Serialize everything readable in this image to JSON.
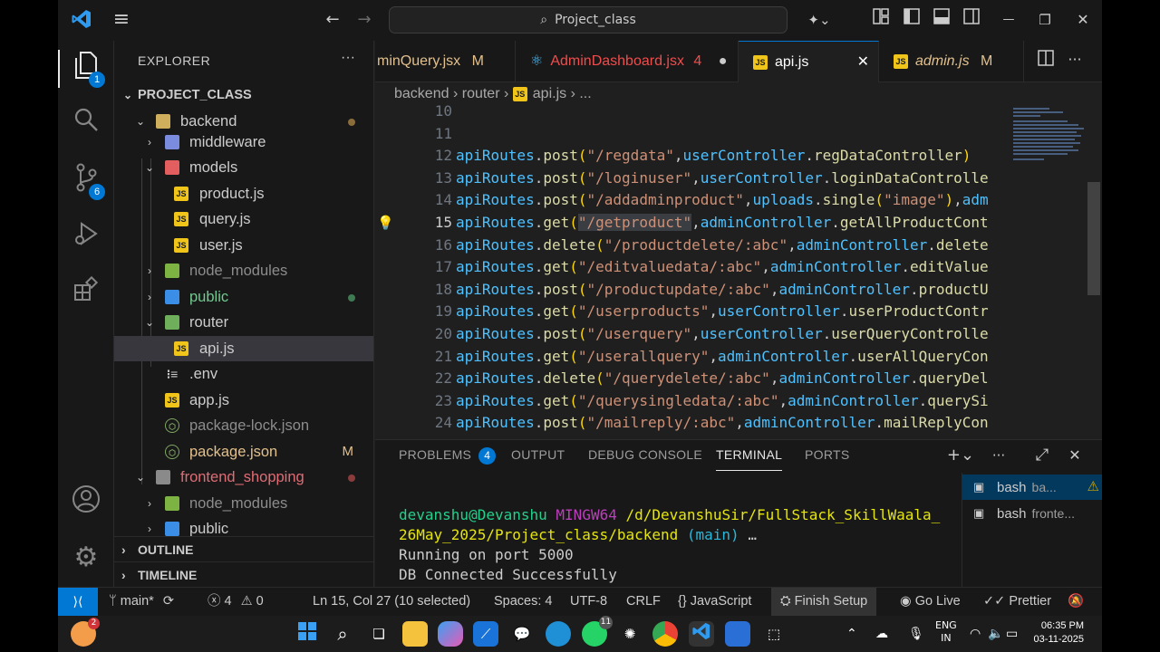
{
  "titlebar": {
    "search_text": "Project_class",
    "back": "←",
    "forward": "→",
    "menu": "≡",
    "copilot": "✦⌄",
    "minimize": "—",
    "maximize": "❐",
    "close": "✕"
  },
  "activity": {
    "explorer_badge": "1",
    "scm_badge": "6"
  },
  "sidebar": {
    "title": "EXPLORER",
    "more": "···",
    "project": "PROJECT_CLASS",
    "tree": [
      {
        "label": "backend",
        "git": "dot"
      },
      {
        "label": "middleware"
      },
      {
        "label": "models"
      },
      {
        "label": "product.js"
      },
      {
        "label": "query.js"
      },
      {
        "label": "user.js"
      },
      {
        "label": "node_modules"
      },
      {
        "label": "public",
        "git": "dot"
      },
      {
        "label": "router"
      },
      {
        "label": "api.js"
      },
      {
        "label": ".env"
      },
      {
        "label": "app.js"
      },
      {
        "label": "package-lock.json"
      },
      {
        "label": "package.json",
        "git": "M"
      },
      {
        "label": "frontend_shopping",
        "git": "dot"
      },
      {
        "label": "node_modules"
      },
      {
        "label": "public"
      }
    ],
    "outline": "OUTLINE",
    "timeline": "TIMELINE"
  },
  "tabs": [
    {
      "label": "minQuery.jsx",
      "status": "M"
    },
    {
      "label": "AdminDashboard.jsx",
      "status": "4"
    },
    {
      "label": "api.js"
    },
    {
      "label": "admin.js",
      "status": "M"
    }
  ],
  "breadcrumb": {
    "folder1": "backend",
    "folder2": "router",
    "file": "api.js",
    "more": "..."
  },
  "code": [
    {
      "n": "10",
      "tokens": []
    },
    {
      "n": "11",
      "tokens": []
    },
    {
      "n": "12",
      "tokens": [
        [
          "var",
          "apiRoutes"
        ],
        [
          "pl",
          "."
        ],
        [
          "fn",
          "post"
        ],
        [
          "p",
          "("
        ],
        [
          "str",
          "\"/regdata\""
        ],
        [
          "pl",
          ","
        ],
        [
          "var",
          "userController"
        ],
        [
          "pl",
          "."
        ],
        [
          "fn",
          "regDataController"
        ],
        [
          "p",
          ")"
        ]
      ]
    },
    {
      "n": "13",
      "tokens": [
        [
          "var",
          "apiRoutes"
        ],
        [
          "pl",
          "."
        ],
        [
          "fn",
          "post"
        ],
        [
          "p",
          "("
        ],
        [
          "str",
          "\"/loginuser\""
        ],
        [
          "pl",
          ","
        ],
        [
          "var",
          "userController"
        ],
        [
          "pl",
          "."
        ],
        [
          "fn",
          "loginDataControlle"
        ]
      ]
    },
    {
      "n": "14",
      "tokens": [
        [
          "var",
          "apiRoutes"
        ],
        [
          "pl",
          "."
        ],
        [
          "fn",
          "post"
        ],
        [
          "p",
          "("
        ],
        [
          "str",
          "\"/addadminproduct\""
        ],
        [
          "pl",
          ","
        ],
        [
          "var",
          "uploads"
        ],
        [
          "pl",
          "."
        ],
        [
          "fn",
          "single"
        ],
        [
          "p",
          "("
        ],
        [
          "str",
          "\"image\""
        ],
        [
          "p",
          ")"
        ],
        [
          "pl",
          ","
        ],
        [
          "var",
          "adm"
        ]
      ]
    },
    {
      "n": "15",
      "tokens": [
        [
          "var",
          "apiRoutes"
        ],
        [
          "pl",
          "."
        ],
        [
          "fn",
          "get"
        ],
        [
          "p",
          "("
        ],
        [
          "str",
          "\"/getproduct\""
        ],
        [
          "pl",
          ","
        ],
        [
          "var",
          "adminController"
        ],
        [
          "pl",
          "."
        ],
        [
          "fn",
          "getAllProductCont"
        ]
      ]
    },
    {
      "n": "16",
      "tokens": [
        [
          "var",
          "apiRoutes"
        ],
        [
          "pl",
          "."
        ],
        [
          "fn",
          "delete"
        ],
        [
          "p",
          "("
        ],
        [
          "str",
          "\"/productdelete/:abc\""
        ],
        [
          "pl",
          ","
        ],
        [
          "var",
          "adminController"
        ],
        [
          "pl",
          "."
        ],
        [
          "fn",
          "delete"
        ]
      ]
    },
    {
      "n": "17",
      "tokens": [
        [
          "var",
          "apiRoutes"
        ],
        [
          "pl",
          "."
        ],
        [
          "fn",
          "get"
        ],
        [
          "p",
          "("
        ],
        [
          "str",
          "\"/editvaluedata/:abc\""
        ],
        [
          "pl",
          ","
        ],
        [
          "var",
          "adminController"
        ],
        [
          "pl",
          "."
        ],
        [
          "fn",
          "editValue"
        ]
      ]
    },
    {
      "n": "18",
      "tokens": [
        [
          "var",
          "apiRoutes"
        ],
        [
          "pl",
          "."
        ],
        [
          "fn",
          "post"
        ],
        [
          "p",
          "("
        ],
        [
          "str",
          "\"/productupdate/:abc\""
        ],
        [
          "pl",
          ","
        ],
        [
          "var",
          "adminController"
        ],
        [
          "pl",
          "."
        ],
        [
          "fn",
          "productU"
        ]
      ]
    },
    {
      "n": "19",
      "tokens": [
        [
          "var",
          "apiRoutes"
        ],
        [
          "pl",
          "."
        ],
        [
          "fn",
          "get"
        ],
        [
          "p",
          "("
        ],
        [
          "str",
          "\"/userproducts\""
        ],
        [
          "pl",
          ","
        ],
        [
          "var",
          "userController"
        ],
        [
          "pl",
          "."
        ],
        [
          "fn",
          "userProductContr"
        ]
      ]
    },
    {
      "n": "20",
      "tokens": [
        [
          "var",
          "apiRoutes"
        ],
        [
          "pl",
          "."
        ],
        [
          "fn",
          "post"
        ],
        [
          "p",
          "("
        ],
        [
          "str",
          "\"/userquery\""
        ],
        [
          "pl",
          ","
        ],
        [
          "var",
          "userController"
        ],
        [
          "pl",
          "."
        ],
        [
          "fn",
          "userQueryControlle"
        ]
      ]
    },
    {
      "n": "21",
      "tokens": [
        [
          "var",
          "apiRoutes"
        ],
        [
          "pl",
          "."
        ],
        [
          "fn",
          "get"
        ],
        [
          "p",
          "("
        ],
        [
          "str",
          "\"/userallquery\""
        ],
        [
          "pl",
          ","
        ],
        [
          "var",
          "adminController"
        ],
        [
          "pl",
          "."
        ],
        [
          "fn",
          "userAllQueryCon"
        ]
      ]
    },
    {
      "n": "22",
      "tokens": [
        [
          "var",
          "apiRoutes"
        ],
        [
          "pl",
          "."
        ],
        [
          "fn",
          "delete"
        ],
        [
          "p",
          "("
        ],
        [
          "str",
          "\"/querydelete/:abc\""
        ],
        [
          "pl",
          ","
        ],
        [
          "var",
          "adminController"
        ],
        [
          "pl",
          "."
        ],
        [
          "fn",
          "queryDel"
        ]
      ]
    },
    {
      "n": "23",
      "tokens": [
        [
          "var",
          "apiRoutes"
        ],
        [
          "pl",
          "."
        ],
        [
          "fn",
          "get"
        ],
        [
          "p",
          "("
        ],
        [
          "str",
          "\"/querysingledata/:abc\""
        ],
        [
          "pl",
          ","
        ],
        [
          "var",
          "adminController"
        ],
        [
          "pl",
          "."
        ],
        [
          "fn",
          "querySi"
        ]
      ]
    },
    {
      "n": "24",
      "tokens": [
        [
          "var",
          "apiRoutes"
        ],
        [
          "pl",
          "."
        ],
        [
          "fn",
          "post"
        ],
        [
          "p",
          "("
        ],
        [
          "str",
          "\"/mailreply/:abc\""
        ],
        [
          "pl",
          ","
        ],
        [
          "var",
          "adminController"
        ],
        [
          "pl",
          "."
        ],
        [
          "fn",
          "mailReplyCon"
        ]
      ]
    }
  ],
  "panel": {
    "tabs": [
      "PROBLEMS",
      "OUTPUT",
      "DEBUG CONSOLE",
      "TERMINAL",
      "PORTS"
    ],
    "problems_count": "4",
    "terminal": {
      "user": "devanshu@Devanshu",
      "system": "MINGW64",
      "path_line1": "/d/DevanshuSir/FullStack_SkillWaala_",
      "path_line2": "26May_2025/Project_class/backend",
      "branch": "(main)",
      "ellipsis": "…",
      "out1": "Running on port 5000",
      "out2": "DB Connected Successfully"
    },
    "terminals": [
      {
        "name": "bash",
        "sub": "ba..."
      },
      {
        "name": "bash",
        "sub": "fronte..."
      }
    ]
  },
  "status": {
    "branch": "main*",
    "errors": "4",
    "warnings": "0",
    "position": "Ln 15, Col 27 (10 selected)",
    "spaces": "Spaces: 4",
    "encoding": "UTF-8",
    "eol": "CRLF",
    "language": "JavaScript",
    "finish_setup": "Finish Setup",
    "golive": "Go Live",
    "prettier": "Prettier"
  },
  "taskbar": {
    "lang1": "ENG",
    "lang2": "IN",
    "time": "06:35 PM",
    "date": "03-11-2025",
    "notif_badge": "2",
    "whatsapp_badge": "11"
  }
}
